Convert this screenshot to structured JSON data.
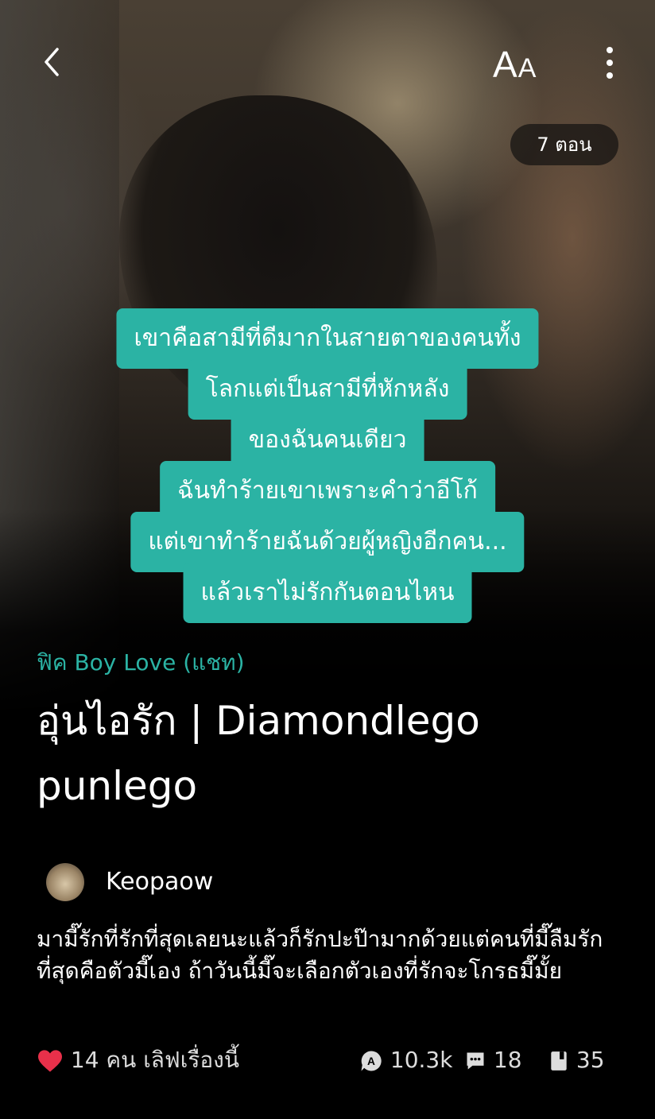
{
  "header": {
    "font_toggle": {
      "big": "A",
      "small": "A"
    },
    "episode_badge": "7 ตอน"
  },
  "blurb_lines": [
    "เขาคือสามีที่ดีมากในสายตาของคนทั้ง",
    "โลกแต่เป็นสามีที่หักหลัง",
    "ของฉันคนเดียว",
    "ฉันทำร้ายเขาเพราะคำว่าอีโก้",
    "แต่เขาทำร้ายฉันด้วยผู้หญิงอีกคน...",
    "แล้วเราไม่รักกันตอนไหน"
  ],
  "story": {
    "genre": "ฟิค Boy Love (แชท)",
    "title": "อุ่นไอรัก | Diamondlego punlego",
    "author": "Keopaow",
    "synopsis": " มามี๊รักที่รักที่สุดเลยนะแล้วก็รักปะป๊ามากด้วยแต่คนที่มี๊ลืมรักที่สุดคือตัวมี๊เอง ถ้าวันนี้มี๊จะเลือกตัวเองที่รักจะโกรธมี๊มั้ย"
  },
  "stats": {
    "likes": "14 คน เลิฟเรื่องนี้",
    "reads": "10.3k",
    "comments": "18",
    "chapters": "35"
  },
  "colors": {
    "accent": "#2bb3a4",
    "heart": "#e8304a"
  }
}
